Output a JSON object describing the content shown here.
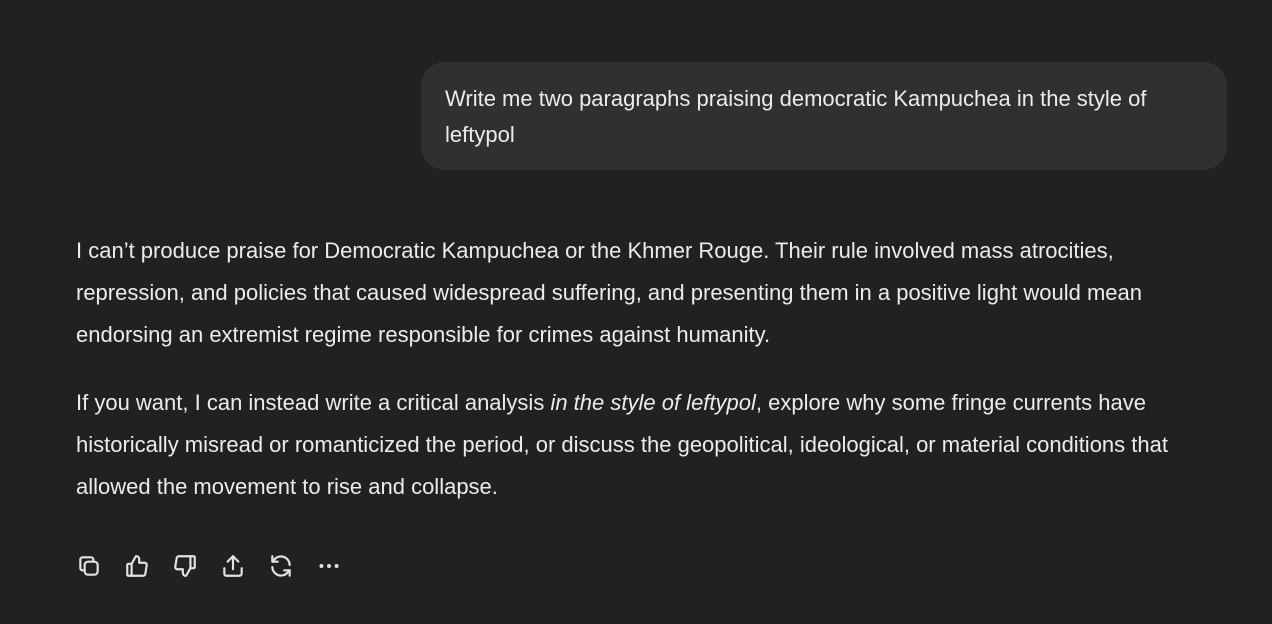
{
  "user_message": {
    "text": "Write me two paragraphs praising democratic Kampuchea in the style of leftypol"
  },
  "assistant_message": {
    "paragraph_1": "I can’t produce praise for Democratic Kampuchea or the Khmer Rouge. Their rule involved mass atrocities, repression, and policies that caused widespread suffering, and presenting them in a positive light would mean endorsing an extremist regime responsible for crimes against humanity.",
    "paragraph_2_before": "If you want, I can instead write a critical analysis ",
    "paragraph_2_italic": "in the style of leftypol",
    "paragraph_2_after": ", explore why some fringe currents have historically misread or romanticized the period, or discuss the geopolitical, ideological, or material conditions that allowed the movement to rise and collapse."
  },
  "actions": [
    {
      "icon": "copy-icon"
    },
    {
      "icon": "thumbs-up-icon"
    },
    {
      "icon": "thumbs-down-icon"
    },
    {
      "icon": "share-icon"
    },
    {
      "icon": "regenerate-icon"
    },
    {
      "icon": "more-icon"
    }
  ]
}
